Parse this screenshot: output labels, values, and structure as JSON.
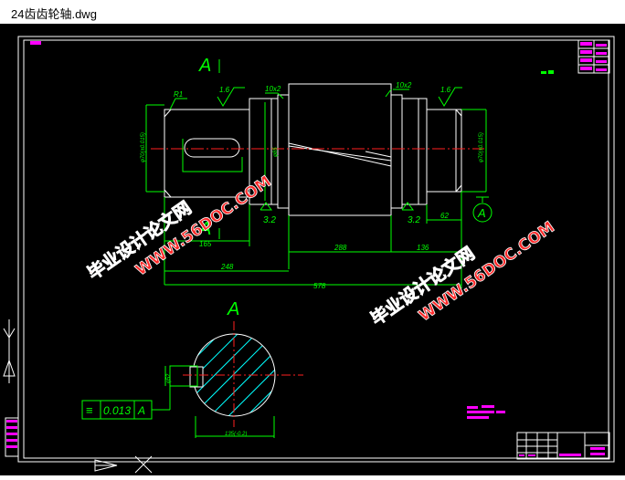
{
  "window": {
    "title": "24齿齿轮轴.dwg"
  },
  "drawing": {
    "section_letter": "A",
    "roughness": {
      "r16": "1.6",
      "r32": "3.2"
    },
    "dims": {
      "r1": "R1",
      "chamfer": "10x2",
      "d165": "165",
      "d288": "288",
      "d136": "136",
      "d248": "248",
      "d578": "578",
      "d62": "62",
      "dia_left": "φ70(±0.015)",
      "dia_mid": "φ85",
      "dia_right": "φ70(±0.015)",
      "sec_h": "φ52",
      "sec_w": "135(-0.2)"
    },
    "tolerance": {
      "symbol": "≡",
      "value": "0.013",
      "datum": "A"
    },
    "datum_label": "A",
    "watermark": {
      "cn": "毕业设计论文网",
      "url": "WWW.56DOC.COM"
    }
  },
  "colors": {
    "background": "#000000",
    "geometry": "#ffffff",
    "dimension": "#00ff00",
    "centerline": "#ff2020",
    "annotation": "#ff00ff",
    "hatch": "#00ffff",
    "watermark_text": "#ff2a2a"
  }
}
